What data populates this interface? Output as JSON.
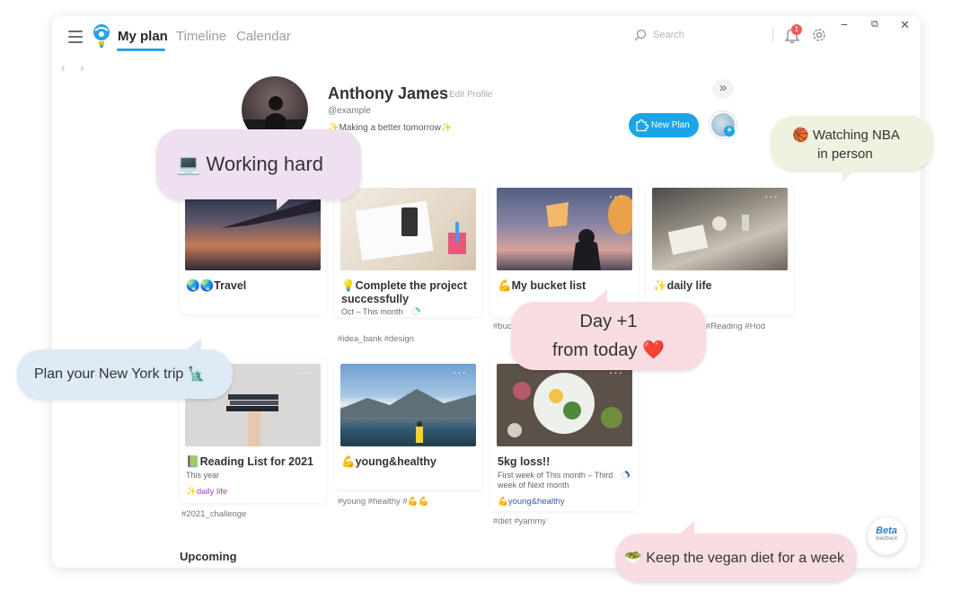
{
  "nav": {
    "tabs": [
      {
        "label": "My plan",
        "active": true
      },
      {
        "label": "Timeline",
        "active": false
      },
      {
        "label": "Calendar",
        "active": false
      }
    ],
    "search_placeholder": "Search",
    "notification_count": "1",
    "icons": [
      "menu-icon",
      "logo-icon",
      "search-icon",
      "bell-icon",
      "gear-icon"
    ]
  },
  "window_controls": {
    "minimize": "−",
    "maximize": "⧉",
    "close": "✕"
  },
  "history": {
    "back": "‹",
    "forward": "›"
  },
  "profile": {
    "name": "Anthony James",
    "edit_label": "Edit Profile",
    "handle": "@example",
    "bio": "✨Making a better tomorrow✨",
    "expand": "»",
    "new_plan_label": "New Plan"
  },
  "cards": [
    {
      "title": "🌏🌏Travel"
    },
    {
      "title": "💡Complete the project successfully",
      "subtitle": "Oct – This month",
      "tags": "#idea_bank #design"
    },
    {
      "title": "💪My bucket list",
      "tags": "#buck"
    },
    {
      "title": "✨daily life",
      "tags": "#Reading #Hod"
    },
    {
      "title": "📗Reading List for 2021",
      "subtitle": "This year",
      "link": "✨daily life",
      "tags": "#2021_challenge"
    },
    {
      "title": "💪young&healthy",
      "tags": "#young #healthy #💪💪"
    },
    {
      "title": "5kg loss!!",
      "subtitle": "First week of This month – Third week of Next month",
      "link": "💪young&healthy",
      "tags": "#diet #yammy"
    }
  ],
  "upcoming_label": "Upcoming",
  "beta": {
    "label": "Beta",
    "sub": "feedback"
  },
  "bubbles": {
    "working": "💻 Working hard",
    "nba_line1": "🏀 Watching NBA",
    "nba_line2": "in person",
    "newyork": "Plan your New York trip 🗽",
    "day_line1": "Day +1",
    "day_line2": "from today ❤️",
    "vegan": "🥗 Keep the vegan diet for a week"
  },
  "colors": {
    "accent": "#1aa6e6",
    "bubble_pink": "#f9dde2",
    "bubble_lavender": "#efe0f1",
    "bubble_blue": "#deebf7",
    "bubble_green": "#eef3df",
    "daily_life_link": "#a23fb5",
    "healthy_link": "#3a5a9c"
  }
}
